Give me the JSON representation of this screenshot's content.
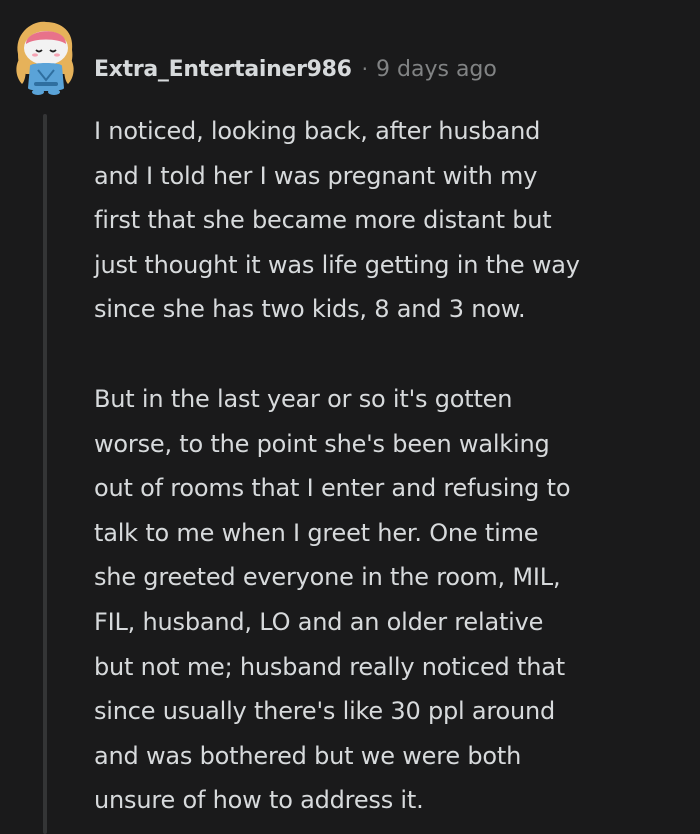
{
  "comment": {
    "username": "Extra_Entertainer986",
    "separator": "·",
    "timestamp": "9 days ago",
    "avatar_icon": "snoo-avatar-icon",
    "paragraphs": [
      "I noticed, looking back, after husband\nand I told her I was pregnant with my\nfirst that she became more distant but\njust thought it was life getting in the way\nsince she has two kids, 8 and 3 now.",
      "But in the last year or so it's gotten\nworse, to the point she's been walking\nout of rooms that I enter and refusing to\ntalk to me when I greet her. One time\nshe greeted everyone in the room, MIL,\nFIL, husband, LO and an older relative\nbut not me; husband really noticed that\nsince usually there's like 30 ppl around\nand was bothered but we were both\nunsure of how to address it."
    ]
  },
  "colors": {
    "background": "#1a1a1b",
    "text": "#d7dadc",
    "meta_text": "#818384",
    "thread_line": "#343536"
  }
}
